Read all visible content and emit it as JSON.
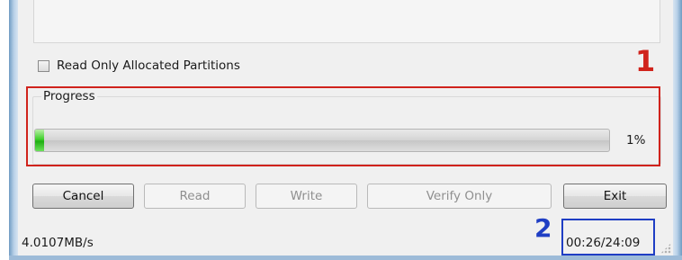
{
  "options": {
    "read_only_allocated_partitions": {
      "label": "Read Only Allocated Partitions",
      "checked": false
    }
  },
  "progress": {
    "group_label": "Progress",
    "percent_text": "1%",
    "fraction": 0.01
  },
  "buttons": {
    "cancel": {
      "label": "Cancel",
      "enabled": true
    },
    "read": {
      "label": "Read",
      "enabled": false
    },
    "write": {
      "label": "Write",
      "enabled": false
    },
    "verify_only": {
      "label": "Verify Only",
      "enabled": false
    },
    "exit": {
      "label": "Exit",
      "enabled": true
    }
  },
  "status": {
    "speed": "4.0107MB/s",
    "time": "00:26/24:09"
  },
  "annotations": {
    "callout_1": {
      "number": "1",
      "color": "#d0231c"
    },
    "callout_2": {
      "number": "2",
      "color": "#1f3ec4"
    }
  },
  "colors": {
    "progress_fill": "#2fbf1f",
    "window_background": "#f0f0f0",
    "frame": "#b9d1e8"
  }
}
